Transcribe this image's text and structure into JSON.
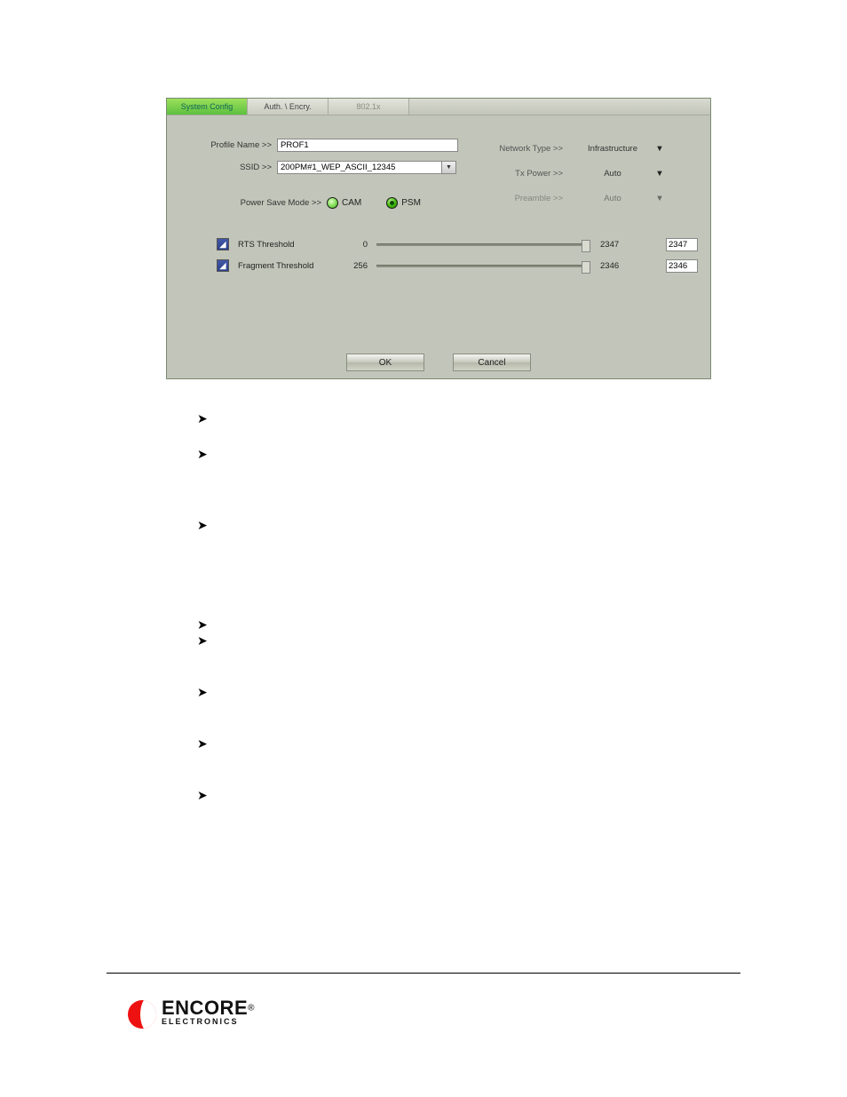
{
  "config": {
    "tabs": {
      "system": "System Config",
      "auth": "Auth. \\ Encry.",
      "dot1x": "802.1x"
    },
    "labels": {
      "profileName": "Profile Name >>",
      "ssid": "SSID >>",
      "powerSaveMode": "Power Save Mode >>",
      "networkType": "Network Type >>",
      "txPower": "Tx Power >>",
      "preamble": "Preamble >>",
      "cam": "CAM",
      "psm": "PSM",
      "rts": "RTS Threshold",
      "frag": "Fragment Threshold",
      "ok": "OK",
      "cancel": "Cancel"
    },
    "values": {
      "profileName": "PROF1",
      "ssid": "200PM#1_WEP_ASCII_12345",
      "networkType": "Infrastructure",
      "txPower": "Auto",
      "preamble": "Auto",
      "rtsMin": "0",
      "rtsMax": "2347",
      "rtsVal": "2347",
      "fragMin": "256",
      "fragMax": "2346",
      "fragVal": "2346"
    }
  },
  "logo": {
    "brand": "ENCORE",
    "sub": "ELECTRONICS",
    "reg": "®"
  }
}
